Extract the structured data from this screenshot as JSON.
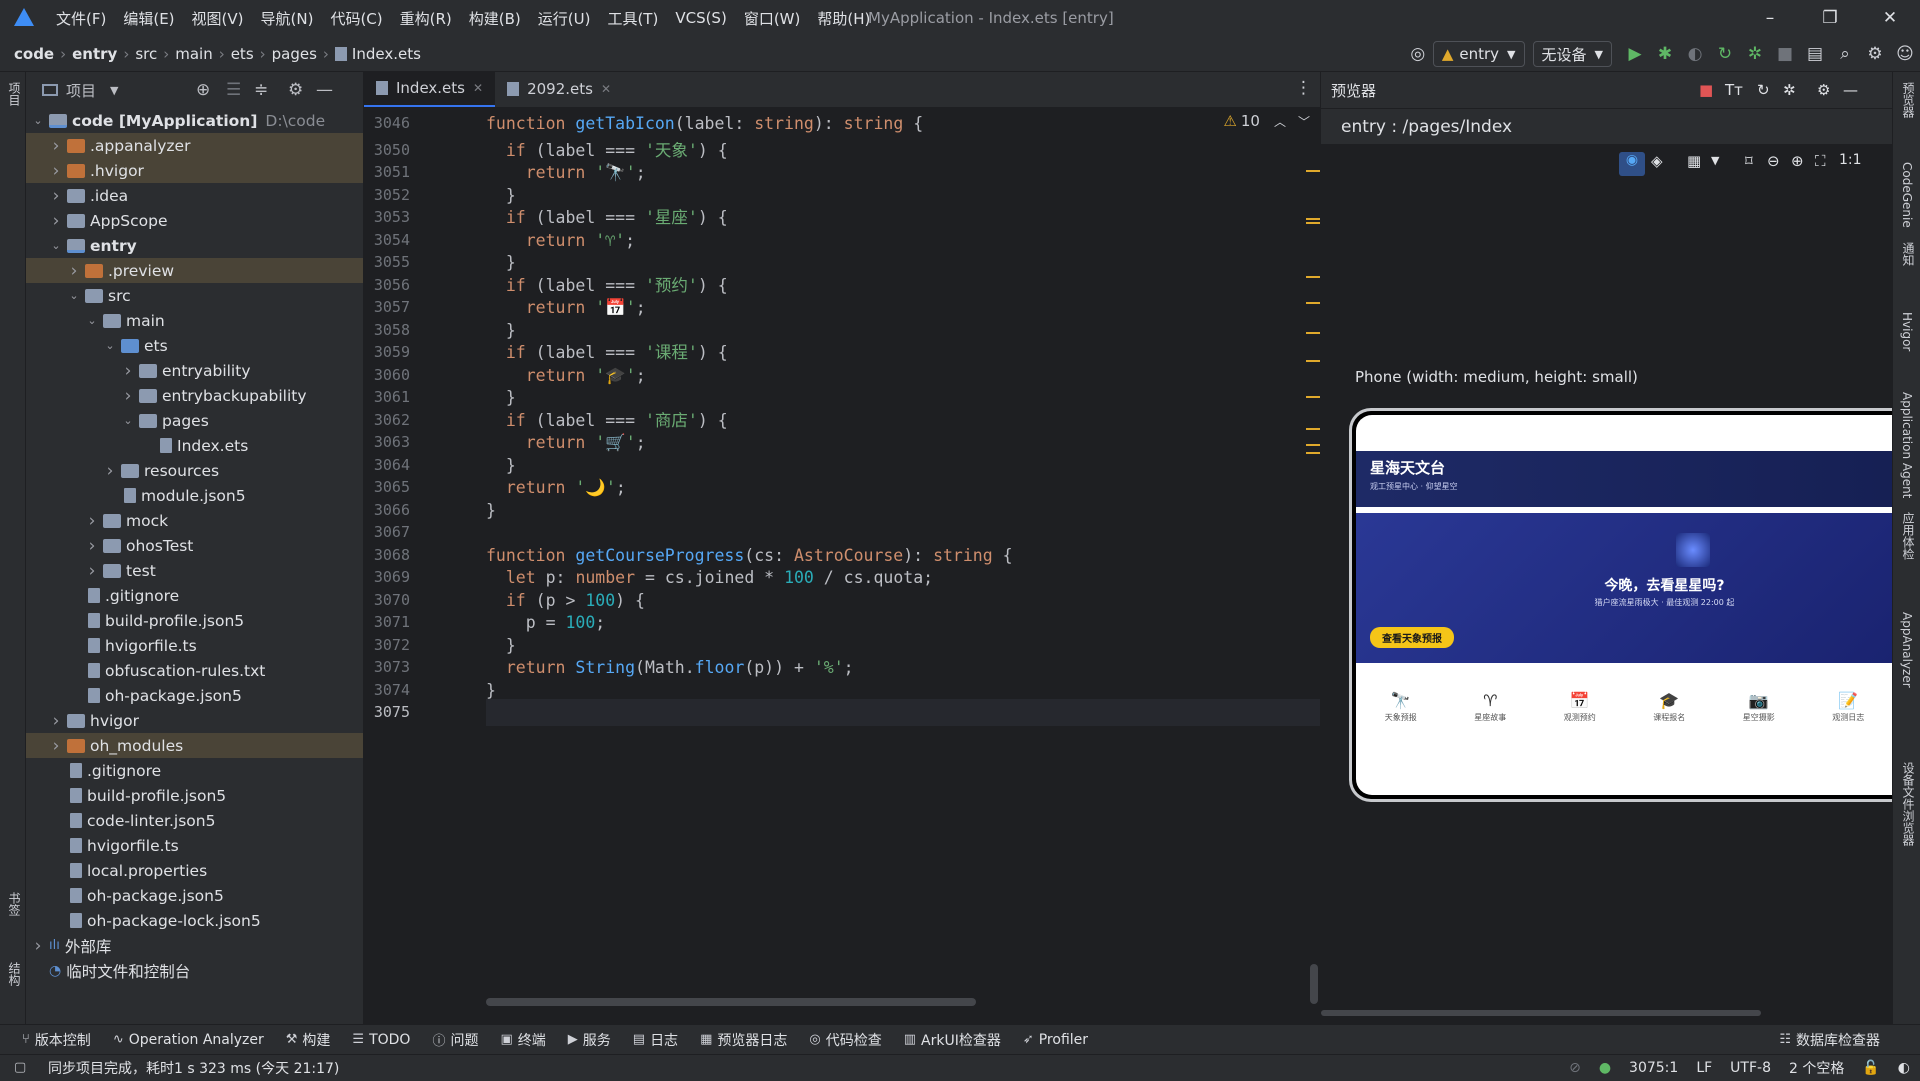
{
  "menu": [
    "文件(F)",
    "编辑(E)",
    "视图(V)",
    "导航(N)",
    "代码(C)",
    "重构(R)",
    "构建(B)",
    "运行(U)",
    "工具(T)",
    "VCS(S)",
    "窗口(W)",
    "帮助(H)"
  ],
  "window_title": "MyApplication - Index.ets [entry]",
  "breadcrumbs": [
    "code",
    "entry",
    "src",
    "main",
    "ets",
    "pages",
    "Index.ets"
  ],
  "run": {
    "config": "entry",
    "device": "无设备"
  },
  "project_panel": {
    "title": "项目"
  },
  "tree": [
    {
      "label": "code [MyApplication]",
      "extra": "D:\\code",
      "indent": 0,
      "arrow": "open",
      "icon": "module",
      "bold": true
    },
    {
      "label": ".appanalyzer",
      "indent": 1,
      "arrow": "closed",
      "icon": "folder-orange",
      "hl": true
    },
    {
      "label": ".hvigor",
      "indent": 1,
      "arrow": "closed",
      "icon": "folder-orange",
      "hl": true
    },
    {
      "label": ".idea",
      "indent": 1,
      "arrow": "closed",
      "icon": "folder"
    },
    {
      "label": "AppScope",
      "indent": 1,
      "arrow": "closed",
      "icon": "folder"
    },
    {
      "label": "entry",
      "indent": 1,
      "arrow": "open",
      "icon": "module",
      "bold": true
    },
    {
      "label": ".preview",
      "indent": 2,
      "arrow": "closed",
      "icon": "folder-orange",
      "hl": true
    },
    {
      "label": "src",
      "indent": 2,
      "arrow": "open",
      "icon": "folder"
    },
    {
      "label": "main",
      "indent": 3,
      "arrow": "open",
      "icon": "folder"
    },
    {
      "label": "ets",
      "indent": 4,
      "arrow": "open",
      "icon": "folder-blue"
    },
    {
      "label": "entryability",
      "indent": 5,
      "arrow": "closed",
      "icon": "folder"
    },
    {
      "label": "entrybackupability",
      "indent": 5,
      "arrow": "closed",
      "icon": "folder"
    },
    {
      "label": "pages",
      "indent": 5,
      "arrow": "open",
      "icon": "folder"
    },
    {
      "label": "Index.ets",
      "indent": 6,
      "arrow": "none",
      "icon": "file"
    },
    {
      "label": "resources",
      "indent": 4,
      "arrow": "closed",
      "icon": "folder"
    },
    {
      "label": "module.json5",
      "indent": 4,
      "arrow": "none",
      "icon": "file"
    },
    {
      "label": "mock",
      "indent": 3,
      "arrow": "closed",
      "icon": "folder"
    },
    {
      "label": "ohosTest",
      "indent": 3,
      "arrow": "closed",
      "icon": "folder"
    },
    {
      "label": "test",
      "indent": 3,
      "arrow": "closed",
      "icon": "folder"
    },
    {
      "label": ".gitignore",
      "indent": 2,
      "arrow": "none",
      "icon": "file"
    },
    {
      "label": "build-profile.json5",
      "indent": 2,
      "arrow": "none",
      "icon": "file"
    },
    {
      "label": "hvigorfile.ts",
      "indent": 2,
      "arrow": "none",
      "icon": "file"
    },
    {
      "label": "obfuscation-rules.txt",
      "indent": 2,
      "arrow": "none",
      "icon": "file"
    },
    {
      "label": "oh-package.json5",
      "indent": 2,
      "arrow": "none",
      "icon": "file"
    },
    {
      "label": "hvigor",
      "indent": 1,
      "arrow": "closed",
      "icon": "folder"
    },
    {
      "label": "oh_modules",
      "indent": 1,
      "arrow": "closed",
      "icon": "folder-orange",
      "hl": true
    },
    {
      "label": ".gitignore",
      "indent": 1,
      "arrow": "none",
      "icon": "file"
    },
    {
      "label": "build-profile.json5",
      "indent": 1,
      "arrow": "none",
      "icon": "file"
    },
    {
      "label": "code-linter.json5",
      "indent": 1,
      "arrow": "none",
      "icon": "file"
    },
    {
      "label": "hvigorfile.ts",
      "indent": 1,
      "arrow": "none",
      "icon": "file"
    },
    {
      "label": "local.properties",
      "indent": 1,
      "arrow": "none",
      "icon": "file"
    },
    {
      "label": "oh-package.json5",
      "indent": 1,
      "arrow": "none",
      "icon": "file"
    },
    {
      "label": "oh-package-lock.json5",
      "indent": 1,
      "arrow": "none",
      "icon": "file"
    },
    {
      "label": "外部库",
      "indent": 0,
      "arrow": "closed",
      "icon": "lib"
    },
    {
      "label": "临时文件和控制台",
      "indent": 0,
      "arrow": "none",
      "icon": "scratch"
    }
  ],
  "tabs": [
    {
      "label": "Index.ets",
      "active": true
    },
    {
      "label": "2092.ets",
      "active": false
    }
  ],
  "warnings": {
    "count": "10"
  },
  "line_numbers": [
    "3046",
    "3050",
    "3051",
    "3052",
    "3053",
    "3054",
    "3055",
    "3056",
    "3057",
    "3058",
    "3059",
    "3060",
    "3061",
    "3062",
    "3063",
    "3064",
    "3065",
    "3066",
    "3067",
    "3068",
    "3069",
    "3070",
    "3071",
    "3072",
    "3073",
    "3074",
    "3075"
  ],
  "code_lines": [
    [
      [
        "kw",
        "function "
      ],
      [
        "fn",
        "getTabIcon"
      ],
      [
        "pu",
        "(label: "
      ],
      [
        "ty",
        "string"
      ],
      [
        "pu",
        "): "
      ],
      [
        "ty",
        "string"
      ],
      [
        "pu",
        " {"
      ]
    ],
    [
      [
        "pu",
        "  "
      ],
      [
        "kw",
        "if"
      ],
      [
        "pu",
        " (label === "
      ],
      [
        "st",
        "'天象'"
      ],
      [
        "pu",
        ") {"
      ]
    ],
    [
      [
        "pu",
        "    "
      ],
      [
        "kw",
        "return "
      ],
      [
        "st",
        "'🔭'"
      ],
      [
        "pu",
        ";"
      ]
    ],
    [
      [
        "pu",
        "  }"
      ]
    ],
    [
      [
        "pu",
        "  "
      ],
      [
        "kw",
        "if"
      ],
      [
        "pu",
        " (label === "
      ],
      [
        "st",
        "'星座'"
      ],
      [
        "pu",
        ") {"
      ]
    ],
    [
      [
        "pu",
        "    "
      ],
      [
        "kw",
        "return "
      ],
      [
        "st",
        "'♈'"
      ],
      [
        "pu",
        ";"
      ]
    ],
    [
      [
        "pu",
        "  }"
      ]
    ],
    [
      [
        "pu",
        "  "
      ],
      [
        "kw",
        "if"
      ],
      [
        "pu",
        " (label === "
      ],
      [
        "st",
        "'预约'"
      ],
      [
        "pu",
        ") {"
      ]
    ],
    [
      [
        "pu",
        "    "
      ],
      [
        "kw",
        "return "
      ],
      [
        "st",
        "'📅'"
      ],
      [
        "pu",
        ";"
      ]
    ],
    [
      [
        "pu",
        "  }"
      ]
    ],
    [
      [
        "pu",
        "  "
      ],
      [
        "kw",
        "if"
      ],
      [
        "pu",
        " (label === "
      ],
      [
        "st",
        "'课程'"
      ],
      [
        "pu",
        ") {"
      ]
    ],
    [
      [
        "pu",
        "    "
      ],
      [
        "kw",
        "return "
      ],
      [
        "st",
        "'🎓'"
      ],
      [
        "pu",
        ";"
      ]
    ],
    [
      [
        "pu",
        "  }"
      ]
    ],
    [
      [
        "pu",
        "  "
      ],
      [
        "kw",
        "if"
      ],
      [
        "pu",
        " (label === "
      ],
      [
        "st",
        "'商店'"
      ],
      [
        "pu",
        ") {"
      ]
    ],
    [
      [
        "pu",
        "    "
      ],
      [
        "kw",
        "return "
      ],
      [
        "st",
        "'🛒'"
      ],
      [
        "pu",
        ";"
      ]
    ],
    [
      [
        "pu",
        "  }"
      ]
    ],
    [
      [
        "pu",
        "  "
      ],
      [
        "kw",
        "return "
      ],
      [
        "st",
        "'🌙'"
      ],
      [
        "pu",
        ";"
      ]
    ],
    [
      [
        "pu",
        "}"
      ]
    ],
    [
      [
        "pu",
        ""
      ]
    ],
    [
      [
        "kw",
        "function "
      ],
      [
        "fn",
        "getCourseProgress"
      ],
      [
        "pu",
        "(cs: "
      ],
      [
        "ty",
        "AstroCourse"
      ],
      [
        "pu",
        "): "
      ],
      [
        "ty",
        "string"
      ],
      [
        "pu",
        " {"
      ]
    ],
    [
      [
        "pu",
        "  "
      ],
      [
        "kw",
        "let "
      ],
      [
        "pu",
        "p: "
      ],
      [
        "ty",
        "number"
      ],
      [
        "pu",
        " = cs.joined * "
      ],
      [
        "nu",
        "100"
      ],
      [
        "pu",
        " / cs.quota;"
      ]
    ],
    [
      [
        "pu",
        "  "
      ],
      [
        "kw",
        "if"
      ],
      [
        "pu",
        " (p > "
      ],
      [
        "nu",
        "100"
      ],
      [
        "pu",
        ") {"
      ]
    ],
    [
      [
        "pu",
        "    p = "
      ],
      [
        "nu",
        "100"
      ],
      [
        "pu",
        ";"
      ]
    ],
    [
      [
        "pu",
        "  }"
      ]
    ],
    [
      [
        "pu",
        "  "
      ],
      [
        "kw",
        "return "
      ],
      [
        "fn",
        "String"
      ],
      [
        "pu",
        "(Math."
      ],
      [
        "fn",
        "floor"
      ],
      [
        "pu",
        "(p)) + "
      ],
      [
        "st",
        "'%'"
      ],
      [
        "pu",
        ";"
      ]
    ],
    [
      [
        "pu",
        "}"
      ]
    ],
    [
      [
        "pu",
        ""
      ]
    ]
  ],
  "preview": {
    "panel_title": "预览器",
    "route": "entry : /pages/Index",
    "device_label": "Phone (width: medium, height: small)",
    "app_title": "星海天文台",
    "app_subtitle": "观工预星中心 · 仰望星空",
    "banner_title": "今晚，去看星星吗?",
    "banner_sub": "猎户座流星雨极大 · 最佳观测 22:00 起",
    "banner_btn": "查看天象预报",
    "nav": [
      {
        "glyph": "🔭",
        "label": "天象预报"
      },
      {
        "glyph": "♈",
        "label": "星座故事"
      },
      {
        "glyph": "📅",
        "label": "观测预约"
      },
      {
        "glyph": "🎓",
        "label": "课程报名"
      },
      {
        "glyph": "📷",
        "label": "星空摄影"
      },
      {
        "glyph": "📝",
        "label": "观测日志"
      }
    ]
  },
  "left_strip": [
    "项目",
    "书签",
    "结构"
  ],
  "right_strip": [
    "预览器",
    "CodeGenie",
    "通知",
    "Hvigor",
    "Application Agent",
    "应用体检",
    "AppAnalyzer",
    "设备文件浏览器"
  ],
  "bottom_tools": [
    {
      "icon": "⑂",
      "label": "版本控制"
    },
    {
      "icon": "∿",
      "label": "Operation Analyzer"
    },
    {
      "icon": "⚒",
      "label": "构建"
    },
    {
      "icon": "☰",
      "label": "TODO"
    },
    {
      "icon": "ⓘ",
      "label": "问题"
    },
    {
      "icon": "▣",
      "label": "终端"
    },
    {
      "icon": "▶",
      "label": "服务"
    },
    {
      "icon": "▤",
      "label": "日志"
    },
    {
      "icon": "▦",
      "label": "预览器日志"
    },
    {
      "icon": "◎",
      "label": "代码检查"
    },
    {
      "icon": "▥",
      "label": "ArkUI检查器"
    },
    {
      "icon": "➶",
      "label": "Profiler"
    }
  ],
  "db_inspector": "数据库检查器",
  "status": {
    "message": "同步项目完成，耗时1 s 323 ms (今天 21:17)",
    "position": "3075:1",
    "line_sep": "LF",
    "encoding": "UTF-8",
    "indent": "2 个空格"
  }
}
